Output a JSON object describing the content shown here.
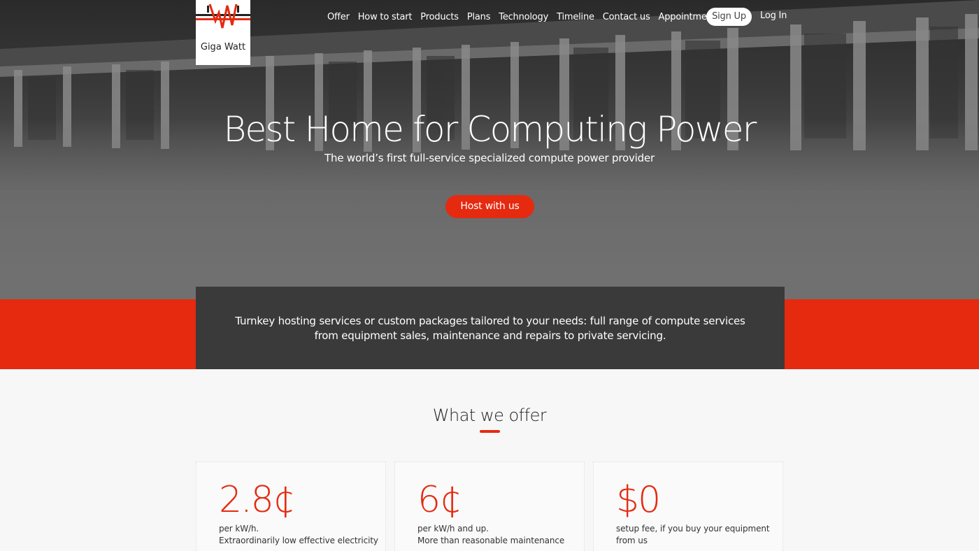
{
  "brand": {
    "name": "Giga Watt",
    "accent": "#e52a10"
  },
  "nav": {
    "items": [
      "Offer",
      "How to start",
      "Products",
      "Plans",
      "Technology",
      "Timeline",
      "Contact us",
      "Appointments"
    ],
    "signup": "Sign Up",
    "login": "Log In"
  },
  "hero": {
    "title": "Best Home for Computing Power",
    "subtitle": "The world’s first full-service specialized compute power provider",
    "cta": "Host with us"
  },
  "band": {
    "text": "Turnkey hosting services or custom packages tailored to your needs: full range of compute services from equipment sales, maintenance and repairs to private servicing."
  },
  "offer": {
    "title": "What we offer",
    "cards": [
      {
        "value": "2.8¢",
        "unit": "per kW/h.",
        "desc": "Extraordinarily low effective electricity"
      },
      {
        "value": "6¢",
        "unit": "per kW/h and up.",
        "desc": "More than reasonable maintenance"
      },
      {
        "value": "$0",
        "unit": "setup fee, if you buy your equipment",
        "desc": "from us"
      }
    ]
  }
}
